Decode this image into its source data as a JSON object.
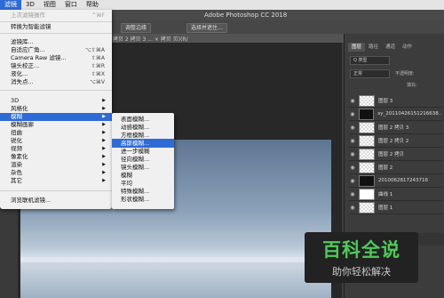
{
  "menubar": {
    "items": [
      "滤镜",
      "3D",
      "视图",
      "窗口",
      "帮助"
    ],
    "active_index": 0
  },
  "app": {
    "title": "Adobe Photoshop CC 2018"
  },
  "optionsbar": {
    "btn_adjust": "调整边缘",
    "btn_select_mask": "选择并遮住..."
  },
  "document": {
    "tab_label": "拷贝 2 拷贝 3 ... × 拷贝 贝)(R/"
  },
  "filter_menu": {
    "last_filter": "上次滤镜操作",
    "last_filter_sc": "^⌘F",
    "convert_smart": "转换为智能滤镜",
    "gallery": "滤镜库...",
    "adaptive_wide": "自适应广角...",
    "adaptive_wide_sc": "⌥⇧⌘A",
    "camera_raw": "Camera Raw 滤镜...",
    "camera_raw_sc": "⇧⌘A",
    "lens_correction": "镜头校正...",
    "lens_correction_sc": "⇧⌘R",
    "liquify": "液化...",
    "liquify_sc": "⇧⌘X",
    "vanishing_point": "消失点...",
    "vanishing_point_sc": "⌥⌘V",
    "cat_3d": "3D",
    "stylize": "风格化",
    "blur": "模糊",
    "blur_gallery": "模糊画廊",
    "distort": "扭曲",
    "sharpen": "锐化",
    "video": "视频",
    "pixelate": "像素化",
    "render": "渲染",
    "noise": "杂色",
    "other": "其它",
    "browse_online": "浏览联机滤镜..."
  },
  "blur_submenu": {
    "items": [
      "表面模糊...",
      "动感模糊...",
      "方框模糊...",
      "高斯模糊...",
      "进一步模糊",
      "径向模糊...",
      "镜头模糊...",
      "模糊",
      "平均",
      "特殊模糊...",
      "形状模糊..."
    ],
    "highlighted_index": 3
  },
  "panel": {
    "tabs": [
      "图层",
      "路径",
      "通道",
      "动作"
    ],
    "active_tab": 0,
    "filter_kind": "Q 类型",
    "blend_mode": "正常",
    "opacity": "不透明度:",
    "fill": "填充:",
    "layers": [
      {
        "name": "图层 3",
        "thumb": "checker"
      },
      {
        "name": "sy_20110426151216638...",
        "thumb": "dark"
      },
      {
        "name": "图层 2 拷贝 3",
        "thumb": "checker"
      },
      {
        "name": "图层 2 拷贝 2",
        "thumb": "checker"
      },
      {
        "name": "图层 2 拷贝",
        "thumb": "checker"
      },
      {
        "name": "图层 2",
        "thumb": "checker"
      },
      {
        "name": "2010062817243716",
        "thumb": "dark"
      },
      {
        "name": "曲线 1",
        "thumb": "mask"
      },
      {
        "name": "图层 1",
        "thumb": "checker"
      }
    ]
  },
  "watermark": {
    "title": "百科全说",
    "subtitle": "助你轻松解决"
  },
  "colors": {
    "accent": "#2f6bd6",
    "menu_bg": "#f0f0f0",
    "ps_bg": "#3d3d3d",
    "watermark_green": "#4fc95a"
  },
  "icons": {
    "submenu_arrow": "triangle-right-icon",
    "visibility": "eye-icon"
  }
}
